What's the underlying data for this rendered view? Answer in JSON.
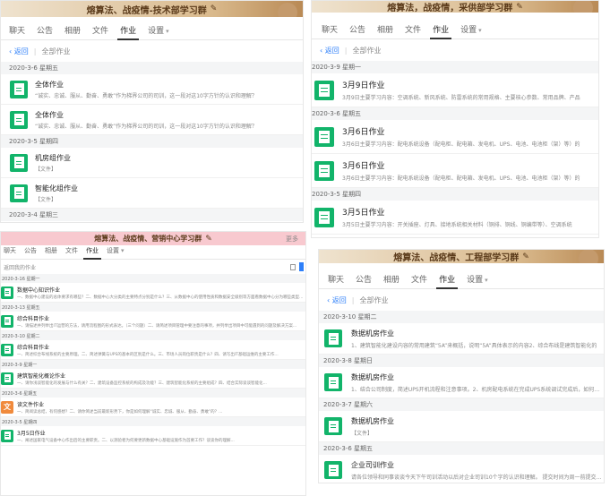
{
  "panel1": {
    "title": "熔算法、战疫情-技术部学习群",
    "tabs": [
      {
        "label": "聊天"
      },
      {
        "label": "公告"
      },
      {
        "label": "相册"
      },
      {
        "label": "文件"
      },
      {
        "label": "作业"
      },
      {
        "label": "设置"
      }
    ],
    "back": "返回",
    "crumb": "全部作业",
    "groups": [
      {
        "date": "2020-3-6 星期五",
        "items": [
          {
            "title": "全体作业",
            "desc": "“诚实、忠诚、服从、勤奋、勇敢”作为梯界公司的司训，这一段对这10字方针的认识和理解？"
          },
          {
            "title": "全体作业",
            "desc": "“诚实、忠诚、服从、勤奋、勇敢”作为梯界公司的司训，这一段对这10字方针的认识和理解？"
          }
        ]
      },
      {
        "date": "2020-3-5 星期四",
        "items": [
          {
            "title": "机房组作业",
            "desc": "【文件】"
          },
          {
            "title": "智能化组作业",
            "desc": "【文件】"
          }
        ]
      },
      {
        "date": "2020-3-4 星期三",
        "items": []
      }
    ]
  },
  "panel2": {
    "title": "熔算法，战疫情，采供部学习群",
    "tabs": [
      {
        "label": "聊天"
      },
      {
        "label": "公告"
      },
      {
        "label": "相册"
      },
      {
        "label": "文件"
      },
      {
        "label": "作业"
      },
      {
        "label": "设置"
      }
    ],
    "back": "返回",
    "crumb": "全部作业",
    "groups": [
      {
        "date": "2020-3-9 星期一",
        "items": [
          {
            "title": "3月9日作业",
            "desc": "3月9日主要学习内容：空调系统、新风系统、防雷系统的常用规格、主要核心参数、常用品牌、产品"
          }
        ]
      },
      {
        "date": "2020-3-6 星期五",
        "items": [
          {
            "title": "3月6日作业",
            "desc": "3月6日主要学习内容：配电系统设备（配电柜、配电箱、发电机、UPS、电池、电池柜（架）等）的"
          },
          {
            "title": "3月6日作业",
            "desc": "3月6日主要学习内容：配电系统设备（配电柜、配电箱、发电机、UPS、电池、电池柜（架）等）的"
          }
        ]
      },
      {
        "date": "2020-3-5 星期四",
        "items": [
          {
            "title": "3月5日作业",
            "desc": "3月5日主要学习内容：开关插座、灯具、接地系统相关材料（铜排、铜线、铜编带等）、空调系统"
          }
        ]
      }
    ]
  },
  "panel3": {
    "title": "熔算法、战疫情、营销中心学习群",
    "more": "更多",
    "tabs": [
      {
        "label": "聊天"
      },
      {
        "label": "公告"
      },
      {
        "label": "相册"
      },
      {
        "label": "文件"
      },
      {
        "label": "作业"
      },
      {
        "label": "设置"
      }
    ],
    "crumb": "返回我的作业",
    "groups": [
      {
        "date": "2020-3-16 星期一",
        "items": [
          {
            "title": "数据中心知识作业",
            "desc": "一、数据中心建设的总体要求有哪些？二、数据中心大分类的主要特点分别是什么？三、从数据中心的使用性质和数据安全级别等方面看数据中心分为哪些类型？四、企业级..."
          }
        ]
      },
      {
        "date": "2020-3-13 星期五",
        "items": [
          {
            "title": "综合科目作业",
            "desc": "一、请描述并列举出IT运营的方法，请用流程图的形式表达。（三个问题）二、请简述项目管理中要注意的事项，并列举出项目中可能遇到的问题及解决方案..."
          }
        ]
      },
      {
        "date": "2020-3-10 星期二",
        "items": [
          {
            "title": "综合科目作业",
            "desc": "一、简述综合布线系统的主要原理。二、简述弹簧与UPS的基本的区别是什么。三、市场人员岗位职责是什么？四、请写出IT基础运维的主要工作..."
          }
        ]
      },
      {
        "date": "2020-3-9 星期一",
        "items": [
          {
            "title": "建筑智能化概论作业",
            "desc": "一、请你浅谈智能化的发展与什么有关？二、建筑设备监控系统的构成及功能？三、建筑智能化系统的主要组成？四、结合实际谈谈智能化..."
          }
        ]
      },
      {
        "date": "2020-3-6 星期五",
        "items": [
          {
            "title": "读文件作业",
            "desc": "一、简阅读总结，有何感想？二、请你简述当前最新形势下，你是如何理解“诚实、忠诚、服从、勤奋、勇敢”的？...",
            "orange": true
          }
        ]
      },
      {
        "date": "2020-3-5 星期四",
        "items": [
          {
            "title": "3月5日作业",
            "desc": "一、阐述国家电气设备中心作出后的主要职责。二、以测验者为何要更新数据中心基础设施作为首要工作？谈谈你的理解..."
          }
        ]
      }
    ]
  },
  "panel4": {
    "title": "熔算法、战疫情、工程部学习群",
    "tabs": [
      {
        "label": "聊天"
      },
      {
        "label": "公告"
      },
      {
        "label": "相册"
      },
      {
        "label": "文件"
      },
      {
        "label": "作业"
      },
      {
        "label": "设置"
      }
    ],
    "back": "返回",
    "crumb": "全部作业",
    "groups": [
      {
        "date": "2020-3-10 星期二",
        "items": [
          {
            "title": "数据机房作业",
            "desc": "1、建筑智能化建设内容的常用建筑“5A”来概括，说明“5A”具体表示的内容2、综合布线是建筑智能化的"
          }
        ]
      },
      {
        "date": "2020-3-8 星期日",
        "items": [
          {
            "title": "数据机房作业",
            "desc": "1、结合公司制度，简述UPS开机流程和注意事项。2、机房配电系统在完成UPS系统调试完成后，如何进行分"
          }
        ]
      },
      {
        "date": "2020-3-7 星期六",
        "items": [
          {
            "title": "数据机房作业",
            "desc": "【文件】"
          }
        ]
      },
      {
        "date": "2020-3-6 星期五",
        "items": [
          {
            "title": "企业司训作业",
            "desc": "请各位领导和同事谈谈今天下午司训活动以后对企业司训10个字的认识和理解。 提交时间为周一前提交（周"
          }
        ]
      }
    ]
  }
}
